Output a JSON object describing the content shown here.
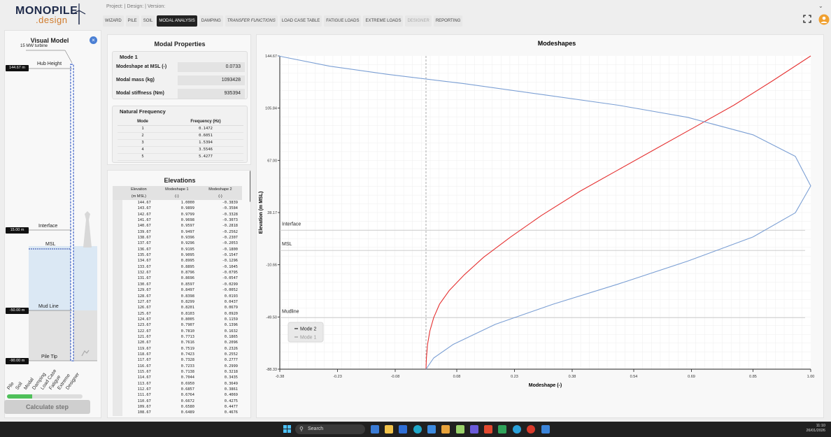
{
  "brand": {
    "line1": "MONOPILE",
    "line2": ".design"
  },
  "header": {
    "project": "Project: | Design: | Version:",
    "caret": "⌄"
  },
  "tabs": [
    {
      "label": "WIZARD"
    },
    {
      "label": "PILE"
    },
    {
      "label": "SOIL"
    },
    {
      "label": "MODAL ANALYSIS",
      "active": true
    },
    {
      "label": "DAMPING"
    },
    {
      "label": "TRANSFER FUNCTIONS"
    },
    {
      "label": "LOAD CASE TABLE"
    },
    {
      "label": "FATIGUE LOADS"
    },
    {
      "label": "EXTREME LOADS"
    },
    {
      "label": "DESIGNER",
      "disabled": true
    },
    {
      "label": "REPORTING"
    }
  ],
  "visual_model": {
    "title": "Visual Model",
    "close": "×",
    "turbine": "15 MW turbine",
    "hub_height": "Hub Height",
    "hub_elev": "144.67 m",
    "interface": "Interface",
    "interface_elev": "15.00 m",
    "msl": "MSL",
    "mudline": "Mud Line",
    "mudline_elev": "-50.00 m",
    "pile_tip": "Pile Tip",
    "pile_tip_elev": "-90.00 m",
    "steps": [
      "Pile",
      "Soil",
      "Modal",
      "Damping",
      "Load Case",
      "Fatigue",
      "Extreme",
      "Designer"
    ],
    "progress": 0.33,
    "calculate": "Calculate step"
  },
  "modal_properties": {
    "title": "Modal Properties",
    "mode_header": "Mode 1",
    "rows": [
      {
        "label": "Modeshape at MSL (-)",
        "value": "0.0733"
      },
      {
        "label": "Modal mass (kg)",
        "value": "1093428"
      },
      {
        "label": "Modal stiffness (Nm)",
        "value": "935394"
      }
    ],
    "nf_title": "Natural Frequency",
    "nf_headers": [
      "Mode",
      "Frequency (Hz)"
    ],
    "nf_rows": [
      [
        "1",
        "0.1472"
      ],
      [
        "2",
        "0.6051"
      ],
      [
        "3",
        "1.5394"
      ],
      [
        "4",
        "3.5546"
      ],
      [
        "5",
        "5.4277"
      ]
    ]
  },
  "elevations": {
    "title": "Elevations",
    "headers": [
      [
        "Elevation",
        "(m MSL)"
      ],
      [
        "Modeshape 1",
        "(-)"
      ],
      [
        "Modeshape 2",
        "(-)"
      ]
    ],
    "rows": [
      [
        "144.67",
        "1.0000",
        "-0.3839"
      ],
      [
        "143.67",
        "0.9899",
        "-0.3584"
      ],
      [
        "142.67",
        "0.9799",
        "-0.3328"
      ],
      [
        "141.67",
        "0.9698",
        "-0.3073"
      ],
      [
        "140.67",
        "0.9597",
        "-0.2818"
      ],
      [
        "139.67",
        "0.9497",
        "-0.2562"
      ],
      [
        "138.67",
        "0.9396",
        "-0.2307"
      ],
      [
        "137.67",
        "0.9296",
        "-0.2053"
      ],
      [
        "136.67",
        "0.9195",
        "-0.1800"
      ],
      [
        "135.67",
        "0.9095",
        "-0.1547"
      ],
      [
        "134.67",
        "0.8995",
        "-0.1296"
      ],
      [
        "133.67",
        "0.8895",
        "-0.1045"
      ],
      [
        "132.67",
        "0.8796",
        "-0.0795"
      ],
      [
        "131.67",
        "0.8696",
        "-0.0547"
      ],
      [
        "130.67",
        "0.8597",
        "-0.0299"
      ],
      [
        "129.67",
        "0.8497",
        "-0.0052"
      ],
      [
        "128.67",
        "0.8398",
        "0.0193"
      ],
      [
        "127.67",
        "0.8299",
        "0.0437"
      ],
      [
        "126.67",
        "0.8201",
        "0.0679"
      ],
      [
        "125.67",
        "0.8103",
        "0.0920"
      ],
      [
        "124.67",
        "0.8005",
        "0.1159"
      ],
      [
        "123.67",
        "0.7907",
        "0.1396"
      ],
      [
        "122.67",
        "0.7810",
        "0.1632"
      ],
      [
        "121.67",
        "0.7713",
        "0.1865"
      ],
      [
        "120.67",
        "0.7616",
        "0.2096"
      ],
      [
        "119.67",
        "0.7519",
        "0.2326"
      ],
      [
        "118.67",
        "0.7423",
        "0.2552"
      ],
      [
        "117.67",
        "0.7328",
        "0.2777"
      ],
      [
        "116.67",
        "0.7233",
        "0.2999"
      ],
      [
        "115.67",
        "0.7138",
        "0.3218"
      ],
      [
        "114.67",
        "0.7044",
        "0.3435"
      ],
      [
        "113.67",
        "0.6950",
        "0.3649"
      ],
      [
        "112.67",
        "0.6857",
        "0.3861"
      ],
      [
        "111.67",
        "0.6764",
        "0.4069"
      ],
      [
        "110.67",
        "0.6672",
        "0.4275"
      ],
      [
        "109.67",
        "0.6580",
        "0.4477"
      ],
      [
        "108.67",
        "0.6489",
        "0.4676"
      ]
    ]
  },
  "taskbar": {
    "search": "Search",
    "time": "11:10",
    "date": "26/01/2026"
  },
  "chart_data": {
    "type": "line",
    "title": "Modeshapes",
    "xlabel": "Modeshape (-)",
    "ylabel": "Elevation (m MSL)",
    "xlim": [
      -0.38,
      1.0
    ],
    "ylim": [
      -88.33,
      144.67
    ],
    "x_ticks": [
      "-0.38",
      "-0.23",
      "-0.08",
      "0.08",
      "0.23",
      "0.38",
      "0.54",
      "0.69",
      "0.85",
      "1.00"
    ],
    "y_ticks": [
      "144.67",
      "105.84",
      "67.00",
      "28.17",
      "-10.66",
      "-49.50",
      "-88.33"
    ],
    "reference_lines": [
      {
        "label": "Interface",
        "y": 15
      },
      {
        "label": "MSL",
        "y": 0
      },
      {
        "label": "Mudline",
        "y": -50
      }
    ],
    "zero_line_x": 0,
    "series": [
      {
        "name": "Mode 2",
        "color": "#e53030",
        "x": [
          0.0,
          0.001,
          0.004,
          0.01,
          0.02,
          0.035,
          0.06,
          0.1,
          0.15,
          0.22,
          0.3,
          0.4,
          0.5,
          0.6,
          0.7,
          0.8,
          0.9,
          1.0
        ],
        "y": [
          -88.33,
          -80,
          -70,
          -60,
          -50,
          -40,
          -30,
          -18,
          -5,
          10,
          26,
          44,
          60,
          76,
          92,
          108,
          126,
          144.67
        ]
      },
      {
        "name": "Mode 1",
        "color": "#7b9fd4",
        "x": [
          0.0,
          0.02,
          0.07,
          0.18,
          0.33,
          0.5,
          0.68,
          0.85,
          0.96,
          1.0,
          0.96,
          0.85,
          0.68,
          0.5,
          0.3,
          0.1,
          -0.1,
          -0.25,
          -0.3839
        ],
        "y": [
          -88.33,
          -80,
          -70,
          -55,
          -40,
          -25,
          -8,
          10,
          28,
          48,
          70,
          86,
          99,
          108,
          116,
          124,
          131,
          137,
          144.67
        ]
      }
    ],
    "legend": {
      "placement": "bottom-left",
      "entries": [
        "Mode 2",
        "Mode 1"
      ]
    },
    "colors": {
      "mode2": "#e53030",
      "mode1": "#7b9fd4"
    }
  }
}
